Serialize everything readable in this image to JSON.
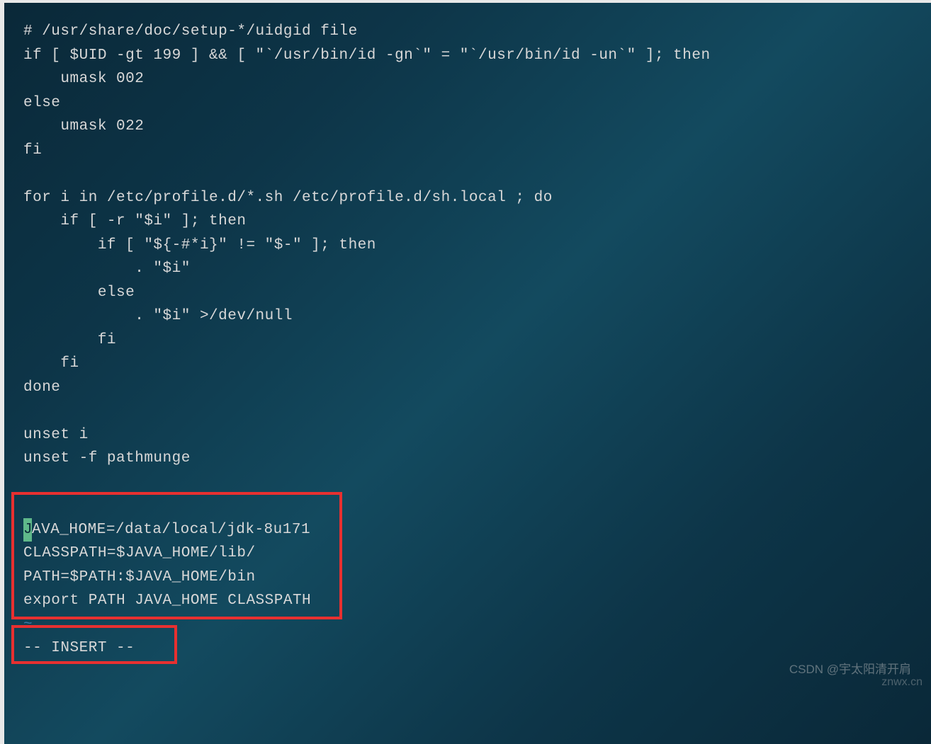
{
  "editor": {
    "lines": {
      "l1": "# /usr/share/doc/setup-*/uidgid file",
      "l2": "if [ $UID -gt 199 ] && [ \"`/usr/bin/id -gn`\" = \"`/usr/bin/id -un`\" ]; then",
      "l3": "    umask 002",
      "l4": "else",
      "l5": "    umask 022",
      "l6": "fi",
      "l7": "",
      "l8": "for i in /etc/profile.d/*.sh /etc/profile.d/sh.local ; do",
      "l9": "    if [ -r \"$i\" ]; then",
      "l10": "        if [ \"${-#*i}\" != \"$-\" ]; then",
      "l11": "            . \"$i\"",
      "l12": "        else",
      "l13": "            . \"$i\" >/dev/null",
      "l14": "        fi",
      "l15": "    fi",
      "l16": "done",
      "l17": "",
      "l18": "unset i",
      "l19": "unset -f pathmunge",
      "l20": "",
      "l21": "",
      "l22_cursor": "J",
      "l22_rest": "AVA_HOME=/data/local/jdk-8u171",
      "l23": "CLASSPATH=$JAVA_HOME/lib/",
      "l24": "PATH=$PATH:$JAVA_HOME/bin",
      "l25": "export PATH JAVA_HOME CLASSPATH",
      "l26_tilde": "~"
    },
    "mode_line": "-- INSERT --"
  },
  "watermark": {
    "text1": "CSDN @宇太阳清开肩",
    "text2": "znwx.cn"
  }
}
